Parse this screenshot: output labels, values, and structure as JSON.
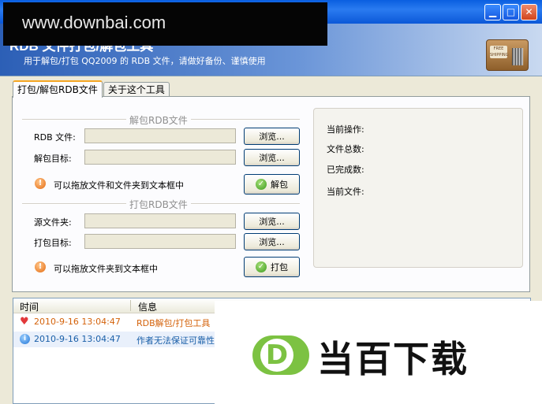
{
  "watermark": {
    "text": "www.downbai.com"
  },
  "titlebar": {
    "minimize": "▁",
    "maximize": "□",
    "close": "✕"
  },
  "banner": {
    "title": "RDB 文件打包/解包工具",
    "subtitle": "用于解包/打包 QQ2009 的 RDB 文件，请做好备份、谨慎使用",
    "logo_label": "FREE SHIPPING"
  },
  "tabs": [
    {
      "label": "打包/解包RDB文件",
      "active": true
    },
    {
      "label": "关于这个工具",
      "active": false
    }
  ],
  "unpack": {
    "section": "解包RDB文件",
    "rdb_file_label": "RDB 文件:",
    "target_label": "解包目标:",
    "browse1": "浏览...",
    "browse2": "浏览...",
    "hint": "可以拖放文件和文件夹到文本框中",
    "action": "解包"
  },
  "pack": {
    "section": "打包RDB文件",
    "source_label": "源文件夹:",
    "target_label": "打包目标:",
    "browse1": "浏览...",
    "browse2": "浏览...",
    "hint": "可以拖放文件夹到文本框中",
    "action": "打包"
  },
  "status": {
    "current_op": "当前操作:",
    "file_count": "文件总数:",
    "done_count": "已完成数:",
    "current_file": "当前文件:"
  },
  "log": {
    "columns": [
      "时间",
      "信息"
    ],
    "rows": [
      {
        "icon": "heart-icon",
        "time": "2010-9-16 13:04:47",
        "message": "RDB解包/打包工具",
        "color": "#d4620a"
      },
      {
        "icon": "info-icon",
        "time": "2010-9-16 13:04:47",
        "message": "作者无法保证可靠性",
        "color": "#1a5fa8"
      }
    ]
  },
  "ad": {
    "logo_letter": "D",
    "text": "当百下载"
  },
  "colors": {
    "accent": "#0a5fe0",
    "ad_green": "#7cc242",
    "selected_row": "#e9f0fb"
  }
}
